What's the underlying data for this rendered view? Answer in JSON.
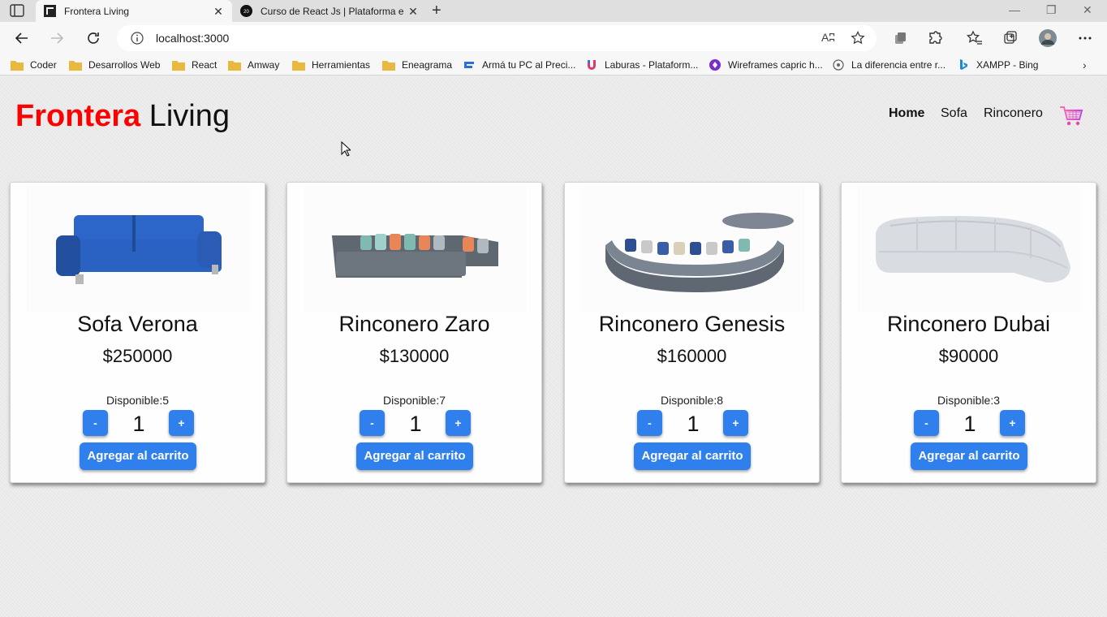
{
  "browser": {
    "tabs": [
      {
        "title": "Frontera Living",
        "active": true
      },
      {
        "title": "Curso de React Js | Plataforma e",
        "active": false
      }
    ],
    "url": "localhost:3000",
    "read_aloud": "Aʭ",
    "bookmarks": [
      {
        "label": "Coder",
        "icon": "folder-icon"
      },
      {
        "label": "Desarrollos Web",
        "icon": "folder-icon"
      },
      {
        "label": "React",
        "icon": "folder-icon"
      },
      {
        "label": "Amway",
        "icon": "folder-icon"
      },
      {
        "label": "Herramientas",
        "icon": "folder-icon"
      },
      {
        "label": "Eneagrama",
        "icon": "folder-icon"
      },
      {
        "label": "Armá tu PC al Preci...",
        "icon": "site-icon"
      },
      {
        "label": "Laburas - Plataform...",
        "icon": "site-icon"
      },
      {
        "label": "Wireframes capric h...",
        "icon": "site-icon"
      },
      {
        "label": "La diferencia entre r...",
        "icon": "site-icon"
      },
      {
        "label": "XAMPP - Bing",
        "icon": "bing-icon"
      }
    ]
  },
  "site": {
    "brand_red": "Frontera",
    "brand_black": "Living",
    "nav": [
      {
        "label": "Home",
        "active": true
      },
      {
        "label": "Sofa",
        "active": false
      },
      {
        "label": "Rinconero",
        "active": false
      }
    ],
    "accent_color": "#2f80ed",
    "brand_color": "#ff0000"
  },
  "products": [
    {
      "name": "Sofa Verona",
      "price": "$250000",
      "stock": "Disponible:5",
      "qty": "1",
      "minus": "-",
      "plus": "+",
      "add": "Agregar al carrito",
      "color": "#2a62c4"
    },
    {
      "name": "Rinconero Zaro",
      "price": "$130000",
      "stock": "Disponible:7",
      "qty": "1",
      "minus": "-",
      "plus": "+",
      "add": "Agregar al carrito",
      "color": "#5f6770"
    },
    {
      "name": "Rinconero Genesis",
      "price": "$160000",
      "stock": "Disponible:8",
      "qty": "1",
      "minus": "-",
      "plus": "+",
      "add": "Agregar al carrito",
      "color": "#6b7380"
    },
    {
      "name": "Rinconero Dubai",
      "price": "$90000",
      "stock": "Disponible:3",
      "qty": "1",
      "minus": "-",
      "plus": "+",
      "add": "Agregar al carrito",
      "color": "#d9dde2"
    }
  ]
}
